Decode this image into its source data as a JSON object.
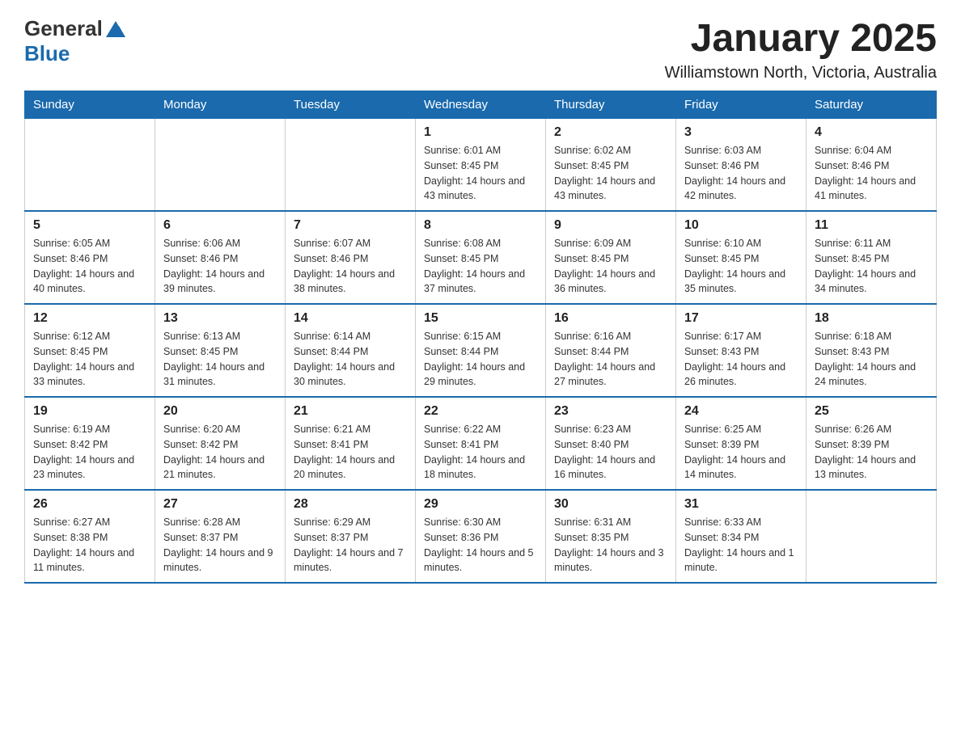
{
  "header": {
    "title": "January 2025",
    "subtitle": "Williamstown North, Victoria, Australia",
    "logo_general": "General",
    "logo_blue": "Blue"
  },
  "days_of_week": [
    "Sunday",
    "Monday",
    "Tuesday",
    "Wednesday",
    "Thursday",
    "Friday",
    "Saturday"
  ],
  "weeks": [
    [
      {
        "day": "",
        "info": ""
      },
      {
        "day": "",
        "info": ""
      },
      {
        "day": "",
        "info": ""
      },
      {
        "day": "1",
        "info": "Sunrise: 6:01 AM\nSunset: 8:45 PM\nDaylight: 14 hours and 43 minutes."
      },
      {
        "day": "2",
        "info": "Sunrise: 6:02 AM\nSunset: 8:45 PM\nDaylight: 14 hours and 43 minutes."
      },
      {
        "day": "3",
        "info": "Sunrise: 6:03 AM\nSunset: 8:46 PM\nDaylight: 14 hours and 42 minutes."
      },
      {
        "day": "4",
        "info": "Sunrise: 6:04 AM\nSunset: 8:46 PM\nDaylight: 14 hours and 41 minutes."
      }
    ],
    [
      {
        "day": "5",
        "info": "Sunrise: 6:05 AM\nSunset: 8:46 PM\nDaylight: 14 hours and 40 minutes."
      },
      {
        "day": "6",
        "info": "Sunrise: 6:06 AM\nSunset: 8:46 PM\nDaylight: 14 hours and 39 minutes."
      },
      {
        "day": "7",
        "info": "Sunrise: 6:07 AM\nSunset: 8:46 PM\nDaylight: 14 hours and 38 minutes."
      },
      {
        "day": "8",
        "info": "Sunrise: 6:08 AM\nSunset: 8:45 PM\nDaylight: 14 hours and 37 minutes."
      },
      {
        "day": "9",
        "info": "Sunrise: 6:09 AM\nSunset: 8:45 PM\nDaylight: 14 hours and 36 minutes."
      },
      {
        "day": "10",
        "info": "Sunrise: 6:10 AM\nSunset: 8:45 PM\nDaylight: 14 hours and 35 minutes."
      },
      {
        "day": "11",
        "info": "Sunrise: 6:11 AM\nSunset: 8:45 PM\nDaylight: 14 hours and 34 minutes."
      }
    ],
    [
      {
        "day": "12",
        "info": "Sunrise: 6:12 AM\nSunset: 8:45 PM\nDaylight: 14 hours and 33 minutes."
      },
      {
        "day": "13",
        "info": "Sunrise: 6:13 AM\nSunset: 8:45 PM\nDaylight: 14 hours and 31 minutes."
      },
      {
        "day": "14",
        "info": "Sunrise: 6:14 AM\nSunset: 8:44 PM\nDaylight: 14 hours and 30 minutes."
      },
      {
        "day": "15",
        "info": "Sunrise: 6:15 AM\nSunset: 8:44 PM\nDaylight: 14 hours and 29 minutes."
      },
      {
        "day": "16",
        "info": "Sunrise: 6:16 AM\nSunset: 8:44 PM\nDaylight: 14 hours and 27 minutes."
      },
      {
        "day": "17",
        "info": "Sunrise: 6:17 AM\nSunset: 8:43 PM\nDaylight: 14 hours and 26 minutes."
      },
      {
        "day": "18",
        "info": "Sunrise: 6:18 AM\nSunset: 8:43 PM\nDaylight: 14 hours and 24 minutes."
      }
    ],
    [
      {
        "day": "19",
        "info": "Sunrise: 6:19 AM\nSunset: 8:42 PM\nDaylight: 14 hours and 23 minutes."
      },
      {
        "day": "20",
        "info": "Sunrise: 6:20 AM\nSunset: 8:42 PM\nDaylight: 14 hours and 21 minutes."
      },
      {
        "day": "21",
        "info": "Sunrise: 6:21 AM\nSunset: 8:41 PM\nDaylight: 14 hours and 20 minutes."
      },
      {
        "day": "22",
        "info": "Sunrise: 6:22 AM\nSunset: 8:41 PM\nDaylight: 14 hours and 18 minutes."
      },
      {
        "day": "23",
        "info": "Sunrise: 6:23 AM\nSunset: 8:40 PM\nDaylight: 14 hours and 16 minutes."
      },
      {
        "day": "24",
        "info": "Sunrise: 6:25 AM\nSunset: 8:39 PM\nDaylight: 14 hours and 14 minutes."
      },
      {
        "day": "25",
        "info": "Sunrise: 6:26 AM\nSunset: 8:39 PM\nDaylight: 14 hours and 13 minutes."
      }
    ],
    [
      {
        "day": "26",
        "info": "Sunrise: 6:27 AM\nSunset: 8:38 PM\nDaylight: 14 hours and 11 minutes."
      },
      {
        "day": "27",
        "info": "Sunrise: 6:28 AM\nSunset: 8:37 PM\nDaylight: 14 hours and 9 minutes."
      },
      {
        "day": "28",
        "info": "Sunrise: 6:29 AM\nSunset: 8:37 PM\nDaylight: 14 hours and 7 minutes."
      },
      {
        "day": "29",
        "info": "Sunrise: 6:30 AM\nSunset: 8:36 PM\nDaylight: 14 hours and 5 minutes."
      },
      {
        "day": "30",
        "info": "Sunrise: 6:31 AM\nSunset: 8:35 PM\nDaylight: 14 hours and 3 minutes."
      },
      {
        "day": "31",
        "info": "Sunrise: 6:33 AM\nSunset: 8:34 PM\nDaylight: 14 hours and 1 minute."
      },
      {
        "day": "",
        "info": ""
      }
    ]
  ]
}
